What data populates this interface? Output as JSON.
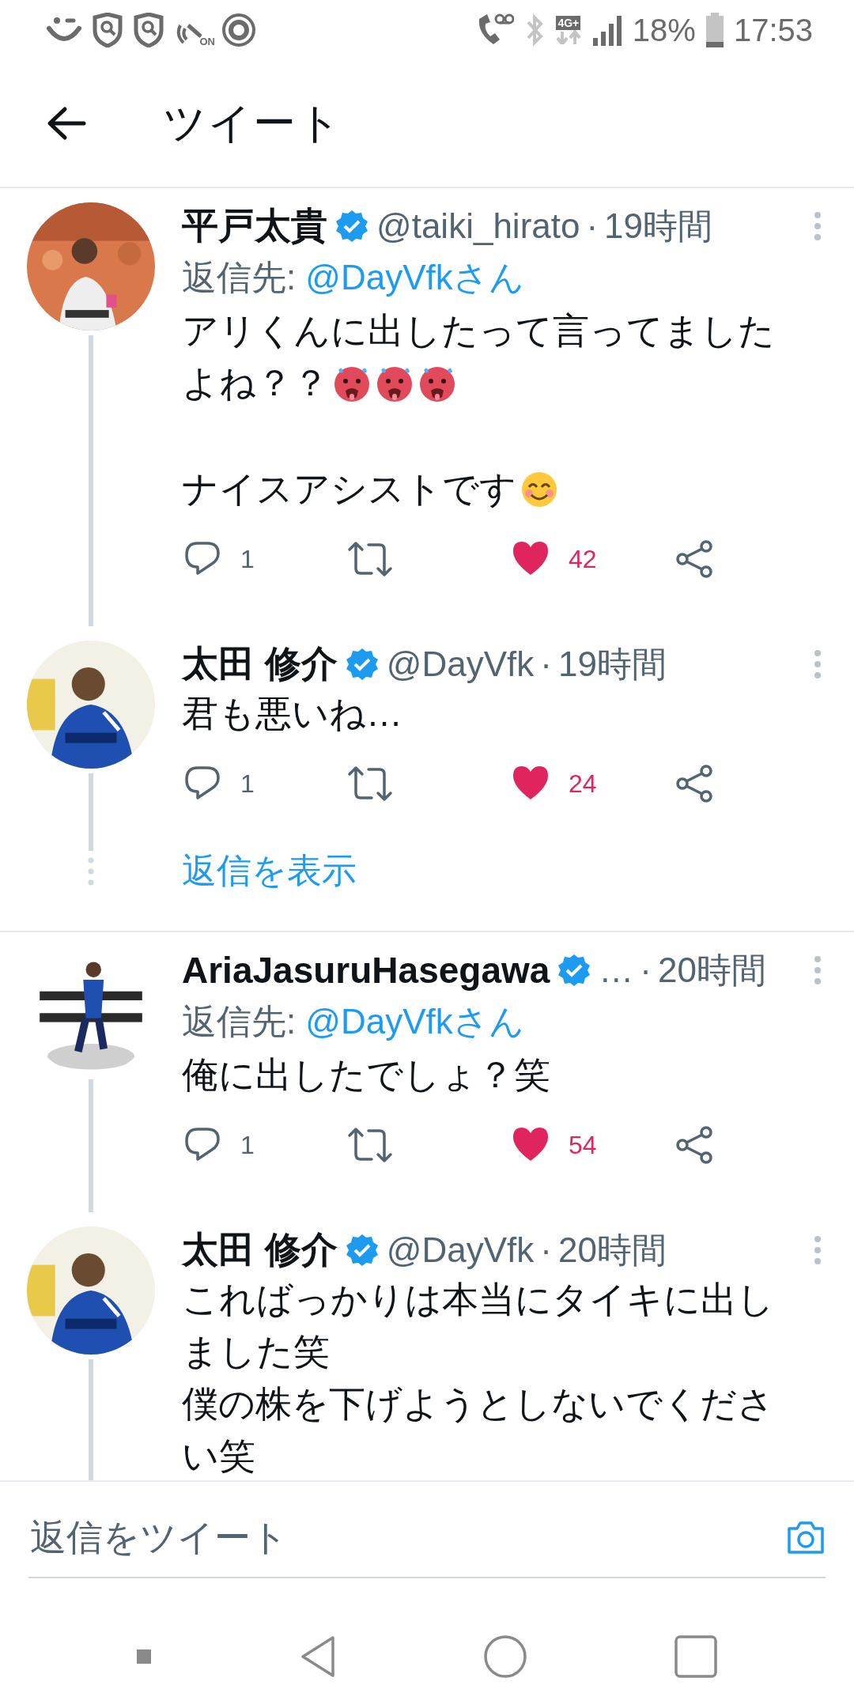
{
  "status_bar": {
    "wifi_call": "ON",
    "network": "4G+",
    "battery": "18%",
    "time": "17:53"
  },
  "header": {
    "title": "ツイート"
  },
  "threads": [
    {
      "tweets": [
        {
          "avatar": {
            "kind": "picture"
          },
          "name": "平戸太貴",
          "verified": true,
          "handle": "@taiki_hirato",
          "separator": "·",
          "time": "19時間",
          "reply_label": "返信先:",
          "reply_to": "@DayVfkさん",
          "thread_below": true,
          "paragraphs": [
            [
              [
                {
                  "kind": "text",
                  "text": "アリくんに出したって言ってました"
                }
              ],
              [
                {
                  "kind": "text",
                  "text": "よね？？"
                },
                {
                  "kind": "hot-face"
                },
                {
                  "kind": "hot-face"
                },
                {
                  "kind": "hot-face"
                }
              ]
            ],
            [
              [
                {
                  "kind": "text",
                  "text": "ナイスアシストです"
                },
                {
                  "kind": "smile-face"
                }
              ]
            ]
          ],
          "replies": "1",
          "likes": "42",
          "liked": true
        },
        {
          "avatar": {
            "kind": "picture"
          },
          "name": "太田 修介",
          "verified": true,
          "handle": "@DayVfk",
          "separator": "·",
          "time": "19時間",
          "thread_below": true,
          "paragraphs": [
            [
              [
                {
                  "kind": "text",
                  "text": "君も悪いね…"
                }
              ]
            ]
          ],
          "replies": "1",
          "likes": "24",
          "liked": true
        }
      ],
      "show_replies": "返信を表示"
    },
    {
      "tweets": [
        {
          "avatar": {
            "kind": "picture"
          },
          "name": "AriaJasuruHasegawa",
          "verified": true,
          "handle": "…",
          "separator": "·",
          "time": "20時間",
          "reply_label": "返信先:",
          "reply_to": "@DayVfkさん",
          "thread_below": true,
          "paragraphs": [
            [
              [
                {
                  "kind": "text",
                  "text": "俺に出したでしょ？笑"
                }
              ]
            ]
          ],
          "replies": "1",
          "likes": "54",
          "liked": true
        },
        {
          "avatar": {
            "kind": "picture"
          },
          "name": "太田 修介",
          "verified": true,
          "handle": "@DayVfk",
          "separator": "·",
          "time": "20時間",
          "thread_below": true,
          "paragraphs": [
            [
              [
                {
                  "kind": "text",
                  "text": "こればっかりは本当にタイキに出し"
                }
              ],
              [
                {
                  "kind": "text",
                  "text": "ました笑"
                }
              ],
              [
                {
                  "kind": "text",
                  "text": "僕の株を下げようとしないでくださ"
                }
              ],
              [
                {
                  "kind": "text",
                  "text": "い笑"
                }
              ]
            ]
          ]
        }
      ]
    }
  ],
  "reply_bar": {
    "placeholder": "返信をツイート"
  }
}
